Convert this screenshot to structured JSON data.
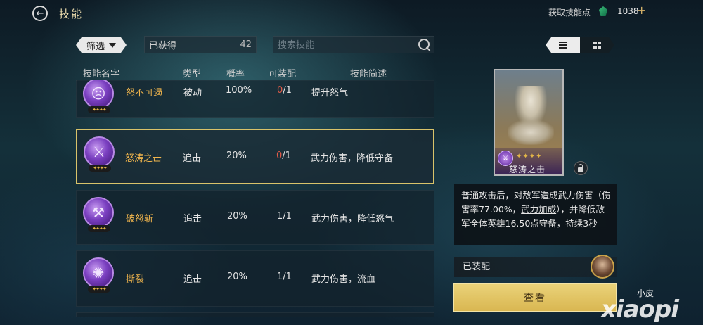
{
  "header": {
    "title": "技能",
    "get_points_label": "获取技能点",
    "points": "1038",
    "plus": "+"
  },
  "filter": {
    "label": "筛选",
    "owned_label": "已获得",
    "owned_count": "42",
    "search_placeholder": "搜索技能"
  },
  "table": {
    "headers": [
      "技能名字",
      "类型",
      "概率",
      "可装配",
      "技能简述"
    ],
    "rows": [
      {
        "icon": "rage-mask-icon",
        "name": "怒不可遏",
        "type": "被动",
        "rate": "100%",
        "equip_current": "0",
        "equip_max": "/1",
        "desc": "提升怒气",
        "stars": "✦✦✦✦"
      },
      {
        "icon": "sword-slash-icon",
        "name": "怒涛之击",
        "type": "追击",
        "rate": "20%",
        "equip_current": "0",
        "equip_max": "/1",
        "desc": "武力伤害，降低守备",
        "stars": "✦✦✦✦",
        "selected": true
      },
      {
        "icon": "axe-icon",
        "name": "破怒斩",
        "type": "追击",
        "rate": "20%",
        "equip_current": "1",
        "equip_max": "/1",
        "desc": "武力伤害，降低怒气",
        "stars": "✦✦✦✦"
      },
      {
        "icon": "claw-tear-icon",
        "name": "撕裂",
        "type": "追击",
        "rate": "20%",
        "equip_current": "1",
        "equip_max": "/1",
        "desc": "武力伤害，流血",
        "stars": "✦✦✦✦"
      }
    ]
  },
  "detail": {
    "card_name": "怒涛之击",
    "card_stars": "✦✦✦✦",
    "desc_part1": "普通攻击后，对敌军造成武力伤害（伤害率77.00%，",
    "desc_link": "武力加成",
    "desc_part2": "），并降低敌军全体英雄16.50点守备，持续3秒",
    "equipped_label": "已装配",
    "view_button": "查看"
  },
  "watermark": {
    "small": "小皮",
    "logo": "xiaopi"
  },
  "colors": {
    "accent_gold": "#d8c36a",
    "skill_name": "#f0b54d",
    "equip_red": "#e05a48"
  }
}
